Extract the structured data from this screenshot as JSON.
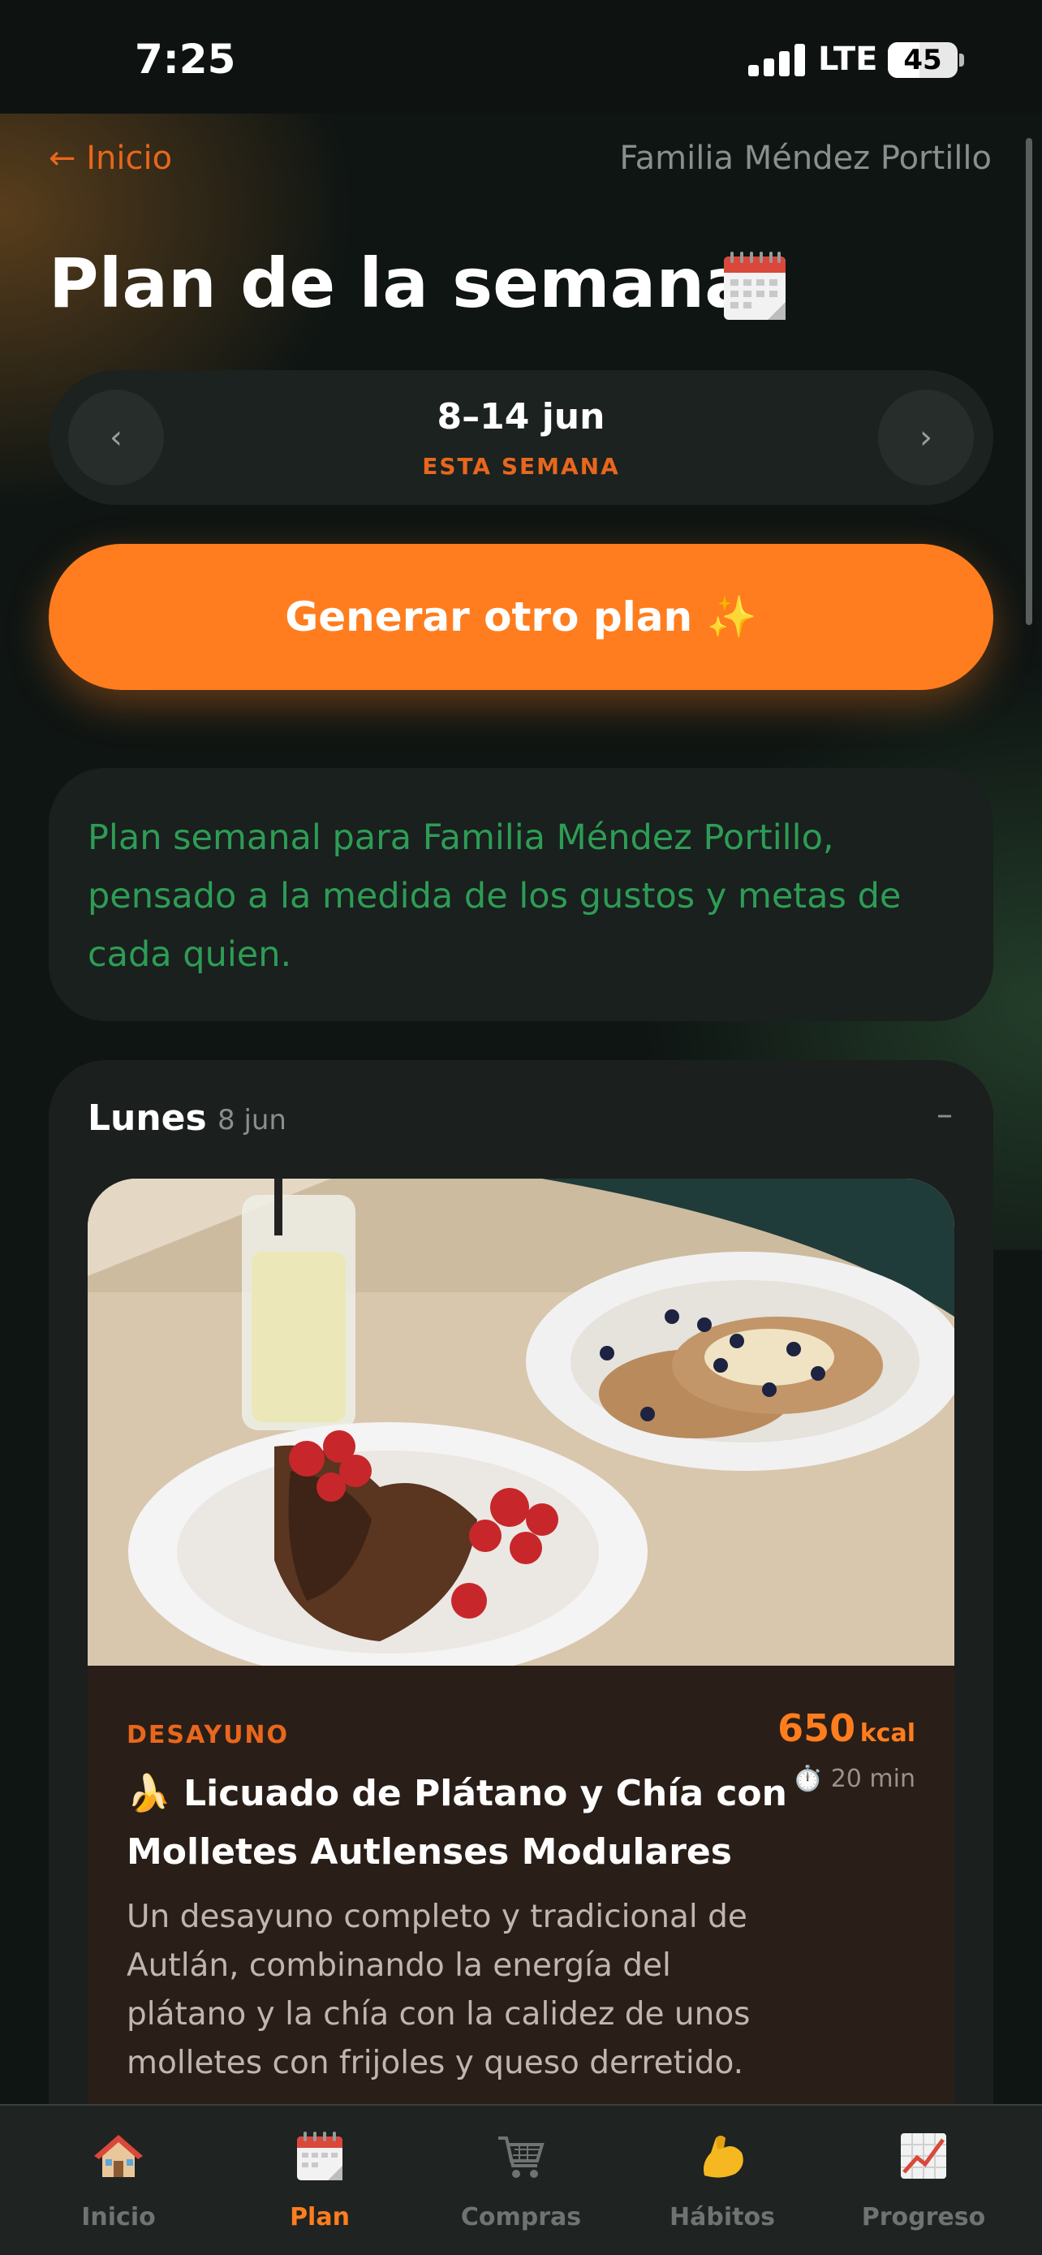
{
  "status_bar": {
    "time": "7:25",
    "network": "LTE",
    "battery": "45"
  },
  "header": {
    "back_label": "← Inicio",
    "family_name": "Familia Méndez Portillo"
  },
  "page": {
    "title": "Plan de la semana",
    "title_icon": "calendar-icon"
  },
  "week_selector": {
    "prev_label": "‹",
    "next_label": "›",
    "range": "8–14 jun",
    "label": "ESTA SEMANA"
  },
  "generate_button": {
    "label": "Generar otro plan ✨"
  },
  "summary": {
    "text": "Plan semanal para Familia Méndez Portillo, pensado a la medida de los gustos y metas de cada quien."
  },
  "day": {
    "name": "Lunes",
    "date": "8 jun",
    "collapse_label": "–",
    "meal": {
      "type": "DESAYUNO",
      "title": "🍌 Licuado de Plátano y Chía con Molletes Autlenses Modulares",
      "kcal": "650",
      "kcal_unit": "kcal",
      "time": "⏱️ 20 min",
      "description": "Un desayuno completo y tradicional de Autlán, combinando la energía del plátano y la chía con la calidez de unos molletes con frijoles y queso derretido."
    }
  },
  "tab_bar": {
    "active": "Plan",
    "tabs": [
      {
        "label": "Inicio",
        "icon": "house-icon"
      },
      {
        "label": "Plan",
        "icon": "calendar-icon"
      },
      {
        "label": "Compras",
        "icon": "shopping-cart-icon"
      },
      {
        "label": "Hábitos",
        "icon": "flexed-biceps-icon"
      },
      {
        "label": "Progreso",
        "icon": "chart-increasing-icon"
      }
    ]
  },
  "colors": {
    "accent": "#ff7d1e",
    "accent_text": "#e8671c",
    "summary_text": "#2e9c55",
    "background": "#0f1513"
  }
}
